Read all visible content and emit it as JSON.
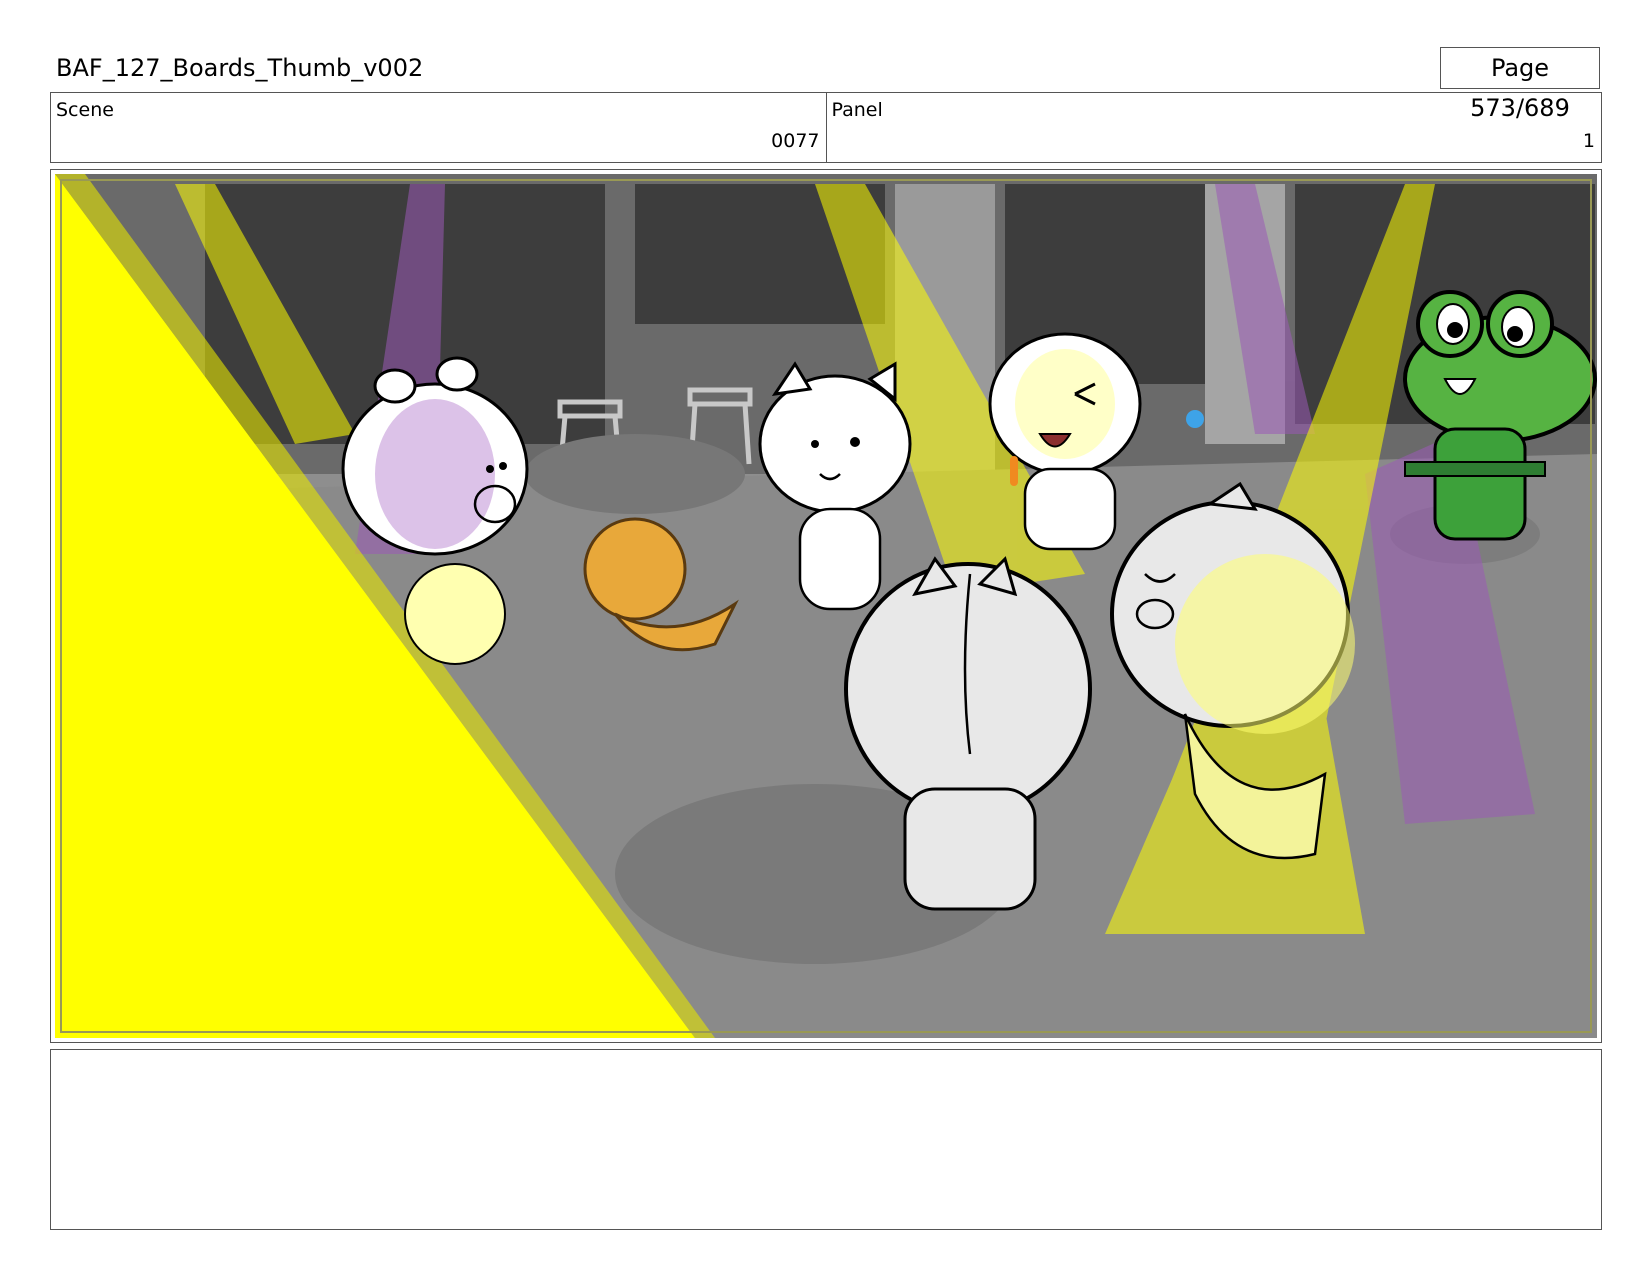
{
  "header": {
    "title": "BAF_127_Boards_Thumb_v002",
    "page": "Page 573/689"
  },
  "info": {
    "scene_label": "Scene",
    "scene_value": "0077",
    "panel_label": "Panel",
    "panel_value": "1"
  },
  "panel_image": {
    "description_icon": "storyboard-panel-illustration",
    "colors": {
      "yellow_light": "#ffff00",
      "purple_light": "#9b59b6",
      "frog_green": "#4caf50",
      "floor_gray": "#8c8c8c",
      "wall_dark": "#3a3a3a"
    }
  },
  "notes": {
    "text": ""
  }
}
